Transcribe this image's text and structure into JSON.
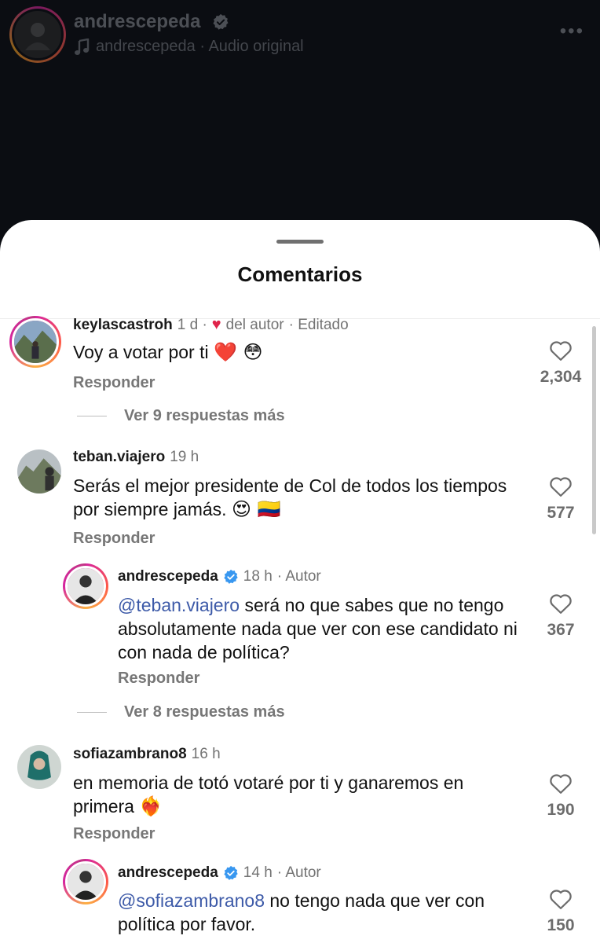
{
  "header": {
    "username": "andrescepeda",
    "audio": "andrescepeda · Audio original",
    "more": "•••"
  },
  "sheet": {
    "title": "Comentarios"
  },
  "comments": [
    {
      "username": "keylascastroh",
      "time": "1 d ·",
      "author_like": "del autor",
      "edited": "· Editado",
      "text": "Voy a votar por ti",
      "emoji": "❤️ 😳",
      "reply": "Responder",
      "likes": "2,304",
      "more_replies": "Ver 9 respuestas más"
    },
    {
      "username": "teban.viajero",
      "time": "19 h",
      "text": "Serás el mejor presidente de Col de todos los tiempos por siempre jamás.",
      "emoji": "😍 🇨🇴",
      "reply": "Responder",
      "likes": "577",
      "replies": [
        {
          "username": "andrescepeda",
          "time": "18 h",
          "badge": "· Autor",
          "mention": "@teban.viajero",
          "text": "será no que sabes que no tengo absolutamente nada que ver con ese candidato ni con nada de política?",
          "reply": "Responder",
          "likes": "367"
        }
      ],
      "more_replies": "Ver 8 respuestas más"
    },
    {
      "username": "sofiazambrano8",
      "time": "16 h",
      "text": "en memoria de totó votaré por ti y ganaremos en primera",
      "emoji": "❤️‍🔥",
      "reply": "Responder",
      "likes": "190",
      "replies": [
        {
          "username": "andrescepeda",
          "time": "14 h",
          "badge": "· Autor",
          "mention": "@sofiazambrano8",
          "text": "no tengo nada que ver con política por favor.",
          "likes": "150"
        }
      ]
    }
  ],
  "icons": {
    "verified": "verified-badge-icon",
    "heart": "heart-outline-icon",
    "music": "music-note-icon",
    "more": "more-horizontal-icon"
  },
  "colors": {
    "verified": "#3897f0",
    "mention": "#3d5aa8",
    "like_heart": "#e0244b"
  }
}
